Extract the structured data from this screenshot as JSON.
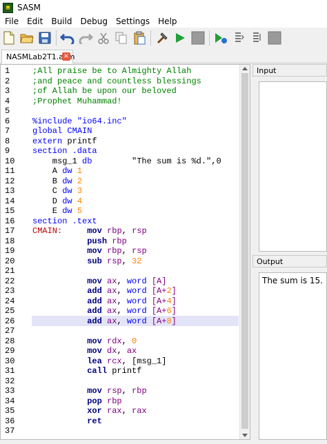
{
  "window": {
    "title": "SASM",
    "icon": "sasm-app-icon"
  },
  "menu": [
    "File",
    "Edit",
    "Build",
    "Debug",
    "Settings",
    "Help"
  ],
  "toolbar": [
    {
      "name": "new-file-icon"
    },
    {
      "name": "open-folder-icon"
    },
    {
      "name": "save-icon"
    },
    {
      "name": "undo-icon"
    },
    {
      "name": "redo-icon"
    },
    {
      "name": "cut-icon"
    },
    {
      "name": "copy-icon"
    },
    {
      "name": "paste-icon"
    },
    {
      "name": "build-hammer-icon"
    },
    {
      "name": "run-icon"
    },
    {
      "name": "stop-icon"
    },
    {
      "name": "debug-icon"
    },
    {
      "name": "step-into-icon"
    },
    {
      "name": "step-over-icon"
    },
    {
      "name": "debug-stop-icon"
    }
  ],
  "tabs": [
    {
      "label": "NASMLab2T1.asm",
      "close": "×"
    }
  ],
  "editor": {
    "highlight_line": 26,
    "lines": [
      [
        [
          ";All praise be to Almighty Allah",
          "cmt"
        ]
      ],
      [
        [
          ";and peace and countless blessings",
          "cmt"
        ]
      ],
      [
        [
          ";of Allah be upon our beloved",
          "cmt"
        ]
      ],
      [
        [
          ";Prophet Muhammad!",
          "cmt"
        ]
      ],
      [],
      [
        [
          "%include ",
          "dir"
        ],
        [
          "\"io64.inc\"",
          "dir"
        ]
      ],
      [
        [
          "global ",
          "dir"
        ],
        [
          "CMAIN",
          "dir"
        ]
      ],
      [
        [
          "extern ",
          "dir"
        ],
        [
          "printf",
          "plain"
        ]
      ],
      [
        [
          "section .data",
          "dir"
        ]
      ],
      [
        [
          "    msg_1 ",
          "plain"
        ],
        [
          "db",
          "dir"
        ],
        [
          "        \"The sum is %d.\",0",
          "plain"
        ]
      ],
      [
        [
          "    A ",
          "plain"
        ],
        [
          "dw ",
          "dir"
        ],
        [
          "1",
          "num"
        ]
      ],
      [
        [
          "    B ",
          "plain"
        ],
        [
          "dw ",
          "dir"
        ],
        [
          "2",
          "num"
        ]
      ],
      [
        [
          "    C ",
          "plain"
        ],
        [
          "dw ",
          "dir"
        ],
        [
          "3",
          "num"
        ]
      ],
      [
        [
          "    D ",
          "plain"
        ],
        [
          "dw ",
          "dir"
        ],
        [
          "4",
          "num"
        ]
      ],
      [
        [
          "    E ",
          "plain"
        ],
        [
          "dw ",
          "dir"
        ],
        [
          "5",
          "num"
        ]
      ],
      [
        [
          "section .text",
          "dir"
        ]
      ],
      [
        [
          "CMAIN:",
          "label"
        ],
        [
          "     ",
          "plain"
        ],
        [
          "mov ",
          "kw"
        ],
        [
          "rbp",
          "reg"
        ],
        [
          ", ",
          "plain"
        ],
        [
          "rsp",
          "reg"
        ]
      ],
      [
        [
          "           ",
          "plain"
        ],
        [
          "push ",
          "kw"
        ],
        [
          "rbp",
          "reg"
        ]
      ],
      [
        [
          "           ",
          "plain"
        ],
        [
          "mov ",
          "kw"
        ],
        [
          "rbp",
          "reg"
        ],
        [
          ", ",
          "plain"
        ],
        [
          "rsp",
          "reg"
        ]
      ],
      [
        [
          "           ",
          "plain"
        ],
        [
          "sub ",
          "kw"
        ],
        [
          "rsp",
          "reg"
        ],
        [
          ", ",
          "plain"
        ],
        [
          "32",
          "num"
        ]
      ],
      [],
      [
        [
          "           ",
          "plain"
        ],
        [
          "mov ",
          "kw"
        ],
        [
          "ax",
          "reg"
        ],
        [
          ", ",
          "plain"
        ],
        [
          "word ",
          "dir"
        ],
        [
          "[A]",
          "reg"
        ]
      ],
      [
        [
          "           ",
          "plain"
        ],
        [
          "add ",
          "kw"
        ],
        [
          "ax",
          "reg"
        ],
        [
          ", ",
          "plain"
        ],
        [
          "word ",
          "dir"
        ],
        [
          "[A+",
          "reg"
        ],
        [
          "2",
          "num"
        ],
        [
          "]",
          "reg"
        ]
      ],
      [
        [
          "           ",
          "plain"
        ],
        [
          "add ",
          "kw"
        ],
        [
          "ax",
          "reg"
        ],
        [
          ", ",
          "plain"
        ],
        [
          "word ",
          "dir"
        ],
        [
          "[A+",
          "reg"
        ],
        [
          "4",
          "num"
        ],
        [
          "]",
          "reg"
        ]
      ],
      [
        [
          "           ",
          "plain"
        ],
        [
          "add ",
          "kw"
        ],
        [
          "ax",
          "reg"
        ],
        [
          ", ",
          "plain"
        ],
        [
          "word ",
          "dir"
        ],
        [
          "[A+",
          "reg"
        ],
        [
          "6",
          "num"
        ],
        [
          "]",
          "reg"
        ]
      ],
      [
        [
          "           ",
          "plain"
        ],
        [
          "add ",
          "kw"
        ],
        [
          "ax",
          "reg"
        ],
        [
          ", ",
          "plain"
        ],
        [
          "word ",
          "dir"
        ],
        [
          "[A+",
          "reg"
        ],
        [
          "8",
          "num"
        ],
        [
          "]",
          "reg"
        ]
      ],
      [],
      [
        [
          "           ",
          "plain"
        ],
        [
          "mov ",
          "kw"
        ],
        [
          "rdx",
          "reg"
        ],
        [
          ", ",
          "plain"
        ],
        [
          "0",
          "num"
        ]
      ],
      [
        [
          "           ",
          "plain"
        ],
        [
          "mov ",
          "kw"
        ],
        [
          "dx",
          "reg"
        ],
        [
          ", ",
          "plain"
        ],
        [
          "ax",
          "reg"
        ]
      ],
      [
        [
          "           ",
          "plain"
        ],
        [
          "lea ",
          "kw"
        ],
        [
          "rcx",
          "reg"
        ],
        [
          ", ",
          "plain"
        ],
        [
          "[msg_1]",
          "plain"
        ]
      ],
      [
        [
          "           ",
          "plain"
        ],
        [
          "call ",
          "kw"
        ],
        [
          "printf",
          "plain"
        ]
      ],
      [],
      [
        [
          "           ",
          "plain"
        ],
        [
          "mov ",
          "kw"
        ],
        [
          "rsp",
          "reg"
        ],
        [
          ", ",
          "plain"
        ],
        [
          "rbp",
          "reg"
        ]
      ],
      [
        [
          "           ",
          "plain"
        ],
        [
          "pop ",
          "kw"
        ],
        [
          "rbp",
          "reg"
        ]
      ],
      [
        [
          "           ",
          "plain"
        ],
        [
          "xor ",
          "kw"
        ],
        [
          "rax",
          "reg"
        ],
        [
          ", ",
          "plain"
        ],
        [
          "rax",
          "reg"
        ]
      ],
      [
        [
          "           ",
          "plain"
        ],
        [
          "ret",
          "kw"
        ]
      ],
      []
    ]
  },
  "panels": {
    "input": {
      "title": "Input"
    },
    "output": {
      "title": "Output",
      "text": "The sum is 15."
    }
  }
}
